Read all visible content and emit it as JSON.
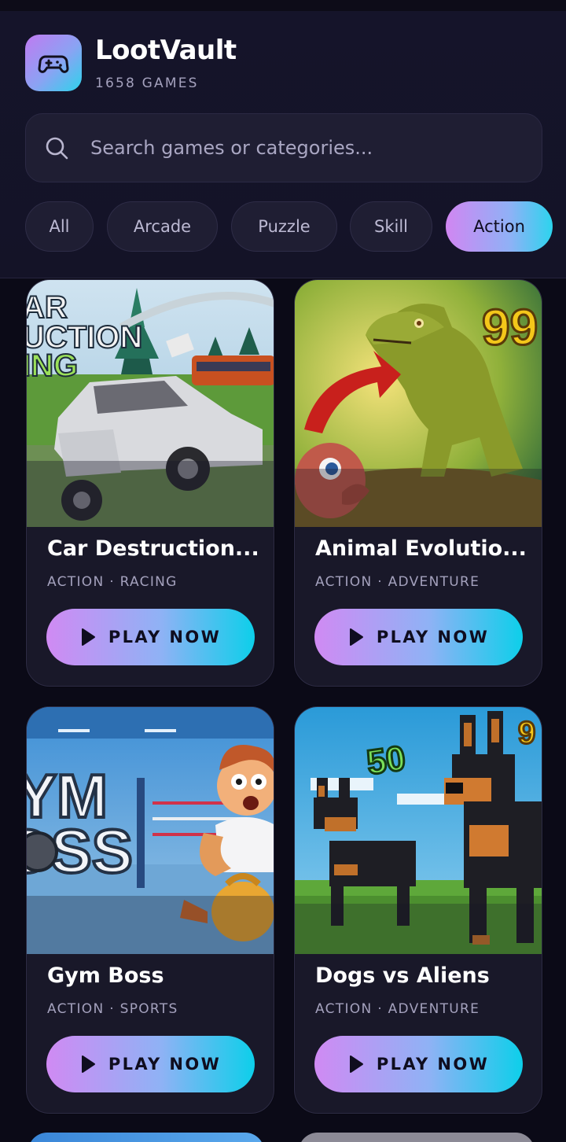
{
  "app": {
    "name": "LootVault",
    "game_count": "1658 GAMES",
    "logo_icon": "gamepad-icon"
  },
  "search": {
    "placeholder": "Search games or categories...",
    "value": "",
    "icon": "search-icon"
  },
  "categories": [
    {
      "label": "All",
      "active": false
    },
    {
      "label": "Arcade",
      "active": false
    },
    {
      "label": "Puzzle",
      "active": false
    },
    {
      "label": "Skill",
      "active": false
    },
    {
      "label": "Action",
      "active": true
    }
  ],
  "games": [
    {
      "title": "Car Destruction...",
      "tags": "ACTION · RACING",
      "button": "PLAY NOW",
      "thumb_text": "AR UCTION ING"
    },
    {
      "title": "Animal Evolutio...",
      "tags": "ACTION · ADVENTURE",
      "button": "PLAY NOW",
      "thumb_text": "99"
    },
    {
      "title": "Gym Boss",
      "tags": "ACTION · SPORTS",
      "button": "PLAY NOW",
      "thumb_text": "YM OSS"
    },
    {
      "title": "Dogs vs Aliens",
      "tags": "ACTION · ADVENTURE",
      "button": "PLAY NOW",
      "thumb_text": "50 9"
    }
  ],
  "colors": {
    "background": "#0b0a17",
    "card": "#191829",
    "accent_start": "#d08af3",
    "accent_end": "#0dcfea"
  }
}
